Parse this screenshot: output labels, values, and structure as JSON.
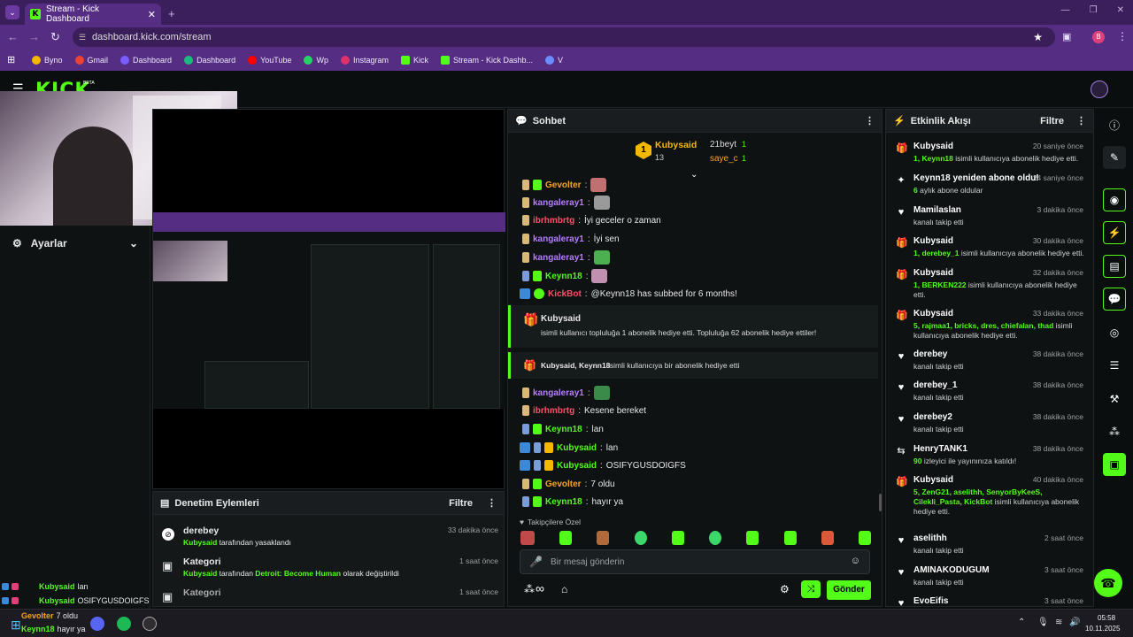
{
  "browser": {
    "tab_title": "Stream - Kick Dashboard",
    "url": "dashboard.kick.com/stream",
    "profile_initial": "B",
    "bookmarks": [
      {
        "label": "Byno",
        "color": "#f5b800"
      },
      {
        "label": "Gmail",
        "color": "#ea4335"
      },
      {
        "label": "Dashboard",
        "color": "#7a5cff"
      },
      {
        "label": "Dashboard",
        "color": "#1eb980"
      },
      {
        "label": "YouTube",
        "color": "#ff0000"
      },
      {
        "label": "Wp",
        "color": "#25d366"
      },
      {
        "label": "Instagram",
        "color": "#e1306c"
      },
      {
        "label": "Kick",
        "color": "#53fc18"
      },
      {
        "label": "Stream - Kick Dashb...",
        "color": "#53fc18"
      },
      {
        "label": "V",
        "color": "#6c8cff"
      }
    ]
  },
  "kick": {
    "logo": "KICK",
    "logo_sup": "BETA",
    "settings_label": "Ayarlar",
    "preview_title_fragment": "i"
  },
  "moderation": {
    "title": "Denetim Eylemleri",
    "filter": "Filtre",
    "items": [
      {
        "title": "derebey",
        "time": "33 dakika önce",
        "actor": "Kubysaid",
        "rest": "tarafından yasaklandı",
        "icon": "ban-icon"
      },
      {
        "title": "Kategori",
        "time": "1 saat önce",
        "actor": "Kubysaid",
        "rest": "tarafından",
        "highlight": "Detroit: Become Human",
        "rest2": "olarak değiştirildi",
        "icon": "category-icon"
      },
      {
        "title": "Kategori",
        "time": "1 saat önce",
        "icon": "category-icon"
      }
    ]
  },
  "chat": {
    "title": "Sohbet",
    "leaderboard": {
      "first_name": "Kubysaid",
      "first_count": "13",
      "rank": "1",
      "second_name": "21beyt",
      "second_count": "1",
      "third_name": "saye_c",
      "third_count": "1"
    },
    "lines": [
      {
        "user": "Gevolter",
        "color": "#f5a623",
        "text": "",
        "emote": "#c07070"
      },
      {
        "user": "kangaleray1",
        "color": "#b67cff",
        "text": "",
        "emote": "#9a9a9a"
      },
      {
        "user": "ibrhmbrtg",
        "color": "#ff4d6a",
        "text": "İyi geceler o zaman"
      },
      {
        "user": "kangaleray1",
        "color": "#b67cff",
        "text": "İyi sen"
      },
      {
        "user": "kangaleray1",
        "color": "#b67cff",
        "text": "",
        "emote": "#4caf50"
      },
      {
        "user": "Keynn18",
        "color": "#53fc18",
        "text": "",
        "emote": "#c090b0"
      },
      {
        "user": "KickBot",
        "color": "#ff4d6a",
        "text": "@Keynn18 has subbed for 6 months!"
      }
    ],
    "gift_card": {
      "name": "Kubysaid",
      "text": "isimli kullanıcı topluluğa 1 abonelik hediye etti. Topluluğa 62 abonelik hediye ettiler!"
    },
    "gift_line": {
      "names": "Kubysaid, Keynn18",
      "text": "isimli kullanıcıya bir abonelik hediye etti"
    },
    "lines2": [
      {
        "user": "kangaleray1",
        "color": "#b67cff",
        "text": "",
        "emote": "#3a8a4a"
      },
      {
        "user": "ibrhmbrtg",
        "color": "#ff4d6a",
        "text": "Kesene bereket"
      },
      {
        "user": "Keynn18",
        "color": "#53fc18",
        "text": "lan"
      },
      {
        "user": "Kubysaid",
        "color": "#53fc18",
        "text": "lan"
      },
      {
        "user": "Kubysaid",
        "color": "#53fc18",
        "text": "OSIFYGUSDOIGFS"
      },
      {
        "user": "Gevolter",
        "color": "#f5a623",
        "text": "7 oldu"
      },
      {
        "user": "Keynn18",
        "color": "#53fc18",
        "text": "hayır ya"
      }
    ],
    "emote_section": "Takipçilere Özel",
    "input_placeholder": "Bir mesaj gönderin",
    "send_label": "Gönder"
  },
  "activity": {
    "title": "Etkinlik Akışı",
    "filter": "Filtre",
    "events": [
      {
        "name": "Kubysaid",
        "time": "20 saniye önce",
        "hl": "1, Keynn18",
        "desc": "isimli kullanıcıya abonelik hediye etti.",
        "icon": "gift-icon"
      },
      {
        "name": "Keynn18 yeniden abone oldu!",
        "time": "24 saniye önce",
        "hl": "6",
        "desc": "aylık abone oldular",
        "icon": "star-icon"
      },
      {
        "name": "Mamilaslan",
        "time": "3 dakika önce",
        "hl": "",
        "desc": "kanalı takip etti",
        "icon": "heart-icon"
      },
      {
        "name": "Kubysaid",
        "time": "30 dakika önce",
        "hl": "1, derebey_1",
        "desc": "isimli kullanıcıya abonelik hediye etti.",
        "icon": "gift-icon"
      },
      {
        "name": "Kubysaid",
        "time": "32 dakika önce",
        "hl": "1, BERKEN222",
        "desc": "isimli kullanıcıya abonelik hediye etti.",
        "icon": "gift-icon"
      },
      {
        "name": "Kubysaid",
        "time": "33 dakika önce",
        "hl": "5, rajmaa1, bricks, dres, chiefalan, thad",
        "desc": "isimli kullanıcıya abonelik hediye etti.",
        "icon": "gift-icon"
      },
      {
        "name": "derebey",
        "time": "38 dakika önce",
        "hl": "",
        "desc": "kanalı takip etti",
        "icon": "heart-icon"
      },
      {
        "name": "derebey_1",
        "time": "38 dakika önce",
        "hl": "",
        "desc": "kanalı takip etti",
        "icon": "heart-icon"
      },
      {
        "name": "derebey2",
        "time": "38 dakika önce",
        "hl": "",
        "desc": "kanalı takip etti",
        "icon": "heart-icon"
      },
      {
        "name": "HenryTANK1",
        "time": "38 dakika önce",
        "hl": "90",
        "desc": "izleyici ile yayınınıza katıldı!",
        "icon": "raid-icon"
      },
      {
        "name": "Kubysaid",
        "time": "40 dakika önce",
        "hl": "5, ZenG21, aselithh, SenyorByKeeS, Cilekli_Pasta, KickBot",
        "desc": "isimli kullanıcıya abonelik hediye etti.",
        "icon": "gift-icon"
      },
      {
        "name": "aselithh",
        "time": "2 saat önce",
        "hl": "",
        "desc": "kanalı takip etti",
        "icon": "heart-icon"
      },
      {
        "name": "AMINAKODUGUM",
        "time": "3 saat önce",
        "hl": "",
        "desc": "kanalı takip etti",
        "icon": "heart-icon"
      },
      {
        "name": "EvoEifis",
        "time": "3 saat önce",
        "hl": "",
        "desc": "",
        "icon": "heart-icon"
      }
    ]
  },
  "overlay_chat": [
    {
      "user": "Kubysaid",
      "text": "lan"
    },
    {
      "user": "Kubysaid",
      "text": "OSIFYGUSDOIGFS"
    },
    {
      "user": "Gevolter",
      "text": "7 oldu"
    },
    {
      "user": "Keynn18",
      "text": "hayır ya"
    }
  ],
  "taskbar": {
    "time": "05:58",
    "date": "10.11.2025"
  },
  "colors": {
    "accent": "#53fc18",
    "bg": "#0b0e0f",
    "panel": "#141819",
    "browser": "#552d82"
  }
}
